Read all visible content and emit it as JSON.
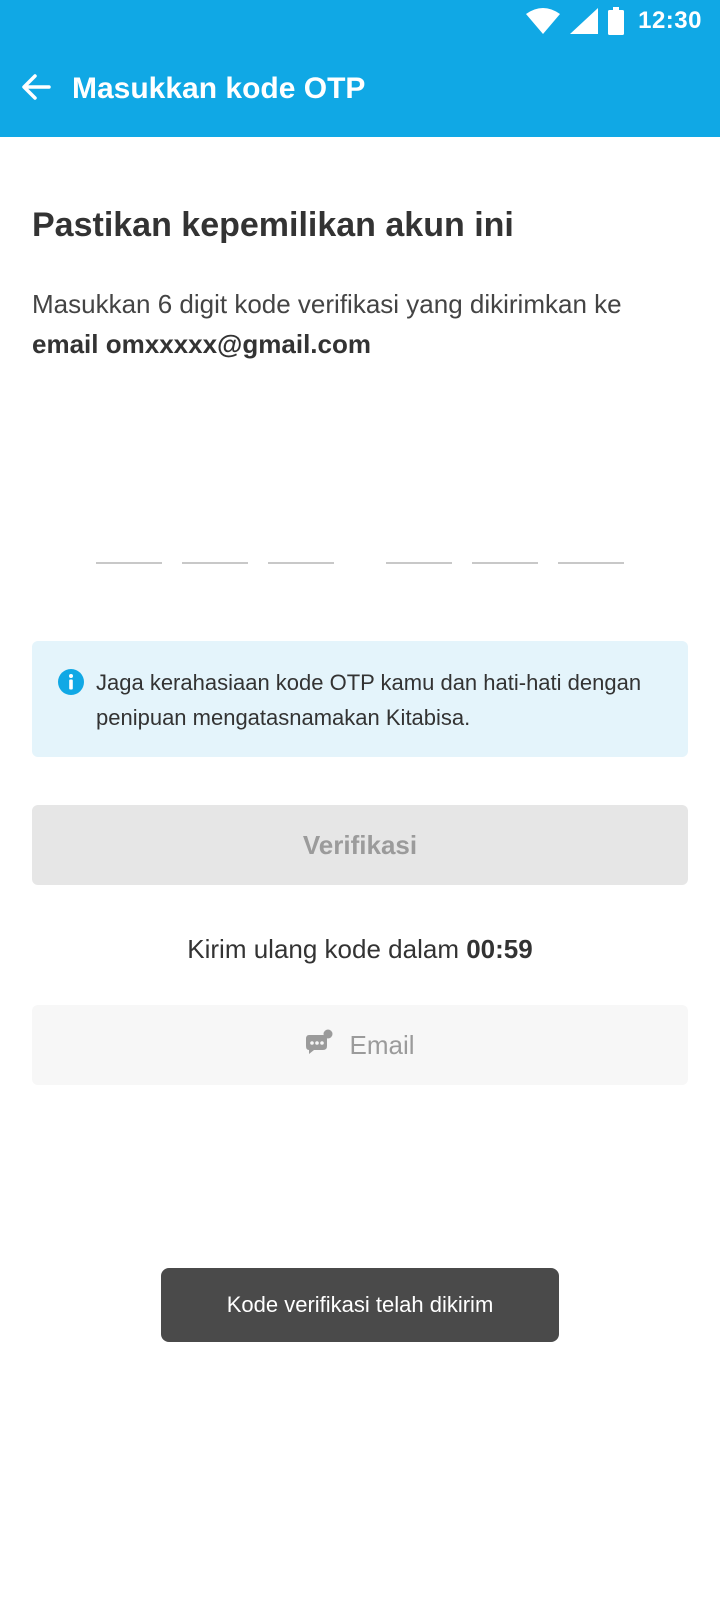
{
  "status_bar": {
    "time": "12:30",
    "icons": [
      "wifi-icon",
      "cellular-signal-icon",
      "battery-icon"
    ]
  },
  "toolbar": {
    "back_icon": "arrow-left-icon",
    "title": "Masukkan kode OTP"
  },
  "main": {
    "heading": "Pastikan kepemilikan akun ini",
    "description_prefix": "Masukkan 6 digit kode verifikasi yang dikirimkan ke ",
    "description_channel": "email",
    "description_email": "omxxxxx@gmail.com",
    "otp_digits": [
      "",
      "",
      "",
      "",
      "",
      ""
    ]
  },
  "info_box": {
    "icon": "info-icon",
    "text": "Jaga kerahasiaan kode OTP kamu dan hati-hati dengan penipuan mengatasnamakan Kitabisa."
  },
  "verify_button": {
    "label": "Verifikasi",
    "enabled": false
  },
  "resend": {
    "prefix": "Kirim ulang kode dalam",
    "countdown": "00:59"
  },
  "email_button": {
    "icon": "chat-bubble-icon",
    "label": "Email",
    "enabled": false
  },
  "toast": {
    "message": "Kode verifikasi telah dikirim"
  },
  "colors": {
    "primary": "#10a8e5",
    "info_background": "#e4f4fb",
    "disabled_button": "#e6e6e6",
    "toast_background": "#4a4a4a"
  }
}
